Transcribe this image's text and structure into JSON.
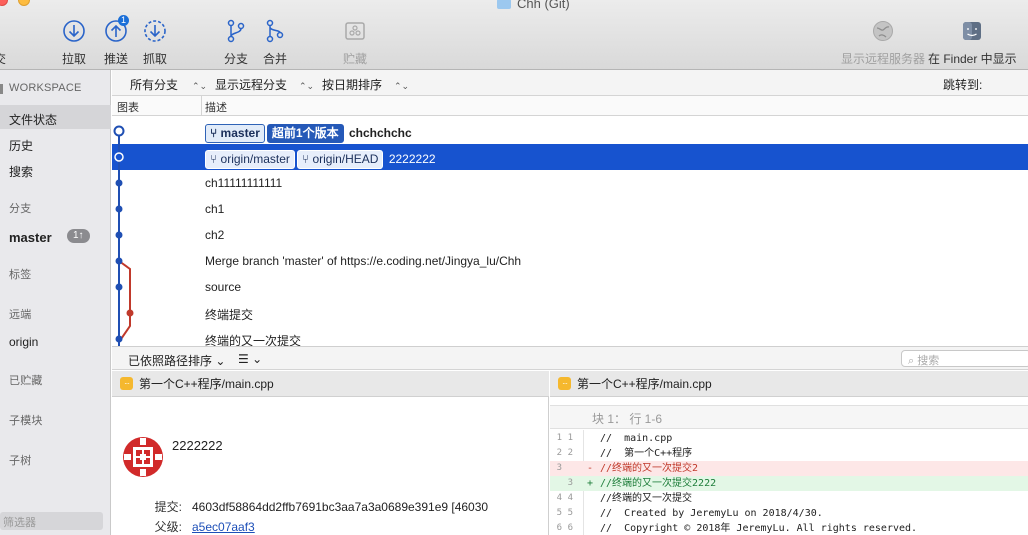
{
  "window": {
    "title": "Chh (Git)"
  },
  "toolbar": {
    "partial_label": "交",
    "pull": "拉取",
    "push": "推送",
    "push_badge": "1",
    "fetch": "抓取",
    "branch": "分支",
    "merge": "合并",
    "stash": "贮藏",
    "show_remote": "显示远程服务器",
    "show_in_finder": "在 Finder 中显示"
  },
  "sidebar": {
    "workspace": "WORKSPACE",
    "file_status": "文件状态",
    "history": "历史",
    "search": "搜索",
    "branches": "分支",
    "master": "master",
    "master_badge": "1↑",
    "tags": "标签",
    "remotes": "远端",
    "origin": "origin",
    "stashes": "已贮藏",
    "submodules": "子模块",
    "subtrees": "子树",
    "filter_placeholder": "筛选器"
  },
  "filterbar": {
    "all_branches": "所有分支",
    "show_remote_branches": "显示远程分支",
    "sort_by_date": "按日期排序",
    "jump_to": "跳转到:"
  },
  "columns": {
    "graph": "图表",
    "description": "描述"
  },
  "commits": [
    {
      "refs": [
        "master"
      ],
      "ahead": "超前1个版本",
      "message": "chchchchc",
      "bold": true
    },
    {
      "refs": [
        "origin/master",
        "origin/HEAD"
      ],
      "message": "2222222",
      "selected": true
    },
    {
      "refs": [],
      "message": "ch11111111111"
    },
    {
      "refs": [],
      "message": "ch1"
    },
    {
      "refs": [],
      "message": "ch2"
    },
    {
      "refs": [],
      "message": "Merge branch 'master' of https://e.coding.net/Jingya_lu/Chh"
    },
    {
      "refs": [],
      "message": "source"
    },
    {
      "refs": [],
      "message": "终端提交"
    },
    {
      "refs": [],
      "message": "终端的又一次提交"
    }
  ],
  "options": {
    "sort_by_path": "已依照路径排序 ⌄",
    "view_mode": "☰ ⌄",
    "search_placeholder": "搜索"
  },
  "detail": {
    "file": "第一个C++程序/main.cpp",
    "message": "2222222",
    "commit_label": "提交:",
    "commit_hash": "4603df58864dd2ffb7691bc3aa7a3a0689e391e9 [46030",
    "parent_label": "父级:",
    "parent_hash": "a5ec07aaf3"
  },
  "diff": {
    "file": "第一个C++程序/main.cpp",
    "hunk": "块 1：  行 1-6",
    "lines": [
      {
        "old": "1",
        "new": "1",
        "sign": "",
        "text": "//  main.cpp",
        "type": "ctx"
      },
      {
        "old": "2",
        "new": "2",
        "sign": "",
        "text": "//  第一个C++程序",
        "type": "ctx"
      },
      {
        "old": "3",
        "new": "",
        "sign": "-",
        "text": "//终端的又一次提交2",
        "type": "del"
      },
      {
        "old": "",
        "new": "3",
        "sign": "+",
        "text": "//终端的又一次提交2222",
        "type": "add"
      },
      {
        "old": "4",
        "new": "4",
        "sign": "",
        "text": "//终端的又一次提交",
        "type": "ctx"
      },
      {
        "old": "5",
        "new": "5",
        "sign": "",
        "text": "//  Created by JeremyLu on 2018/4/30.",
        "type": "ctx"
      },
      {
        "old": "6",
        "new": "6",
        "sign": "",
        "text": "//  Copyright © 2018年 JeremyLu. All rights reserved.",
        "type": "ctx"
      }
    ]
  },
  "colors": {
    "selection": "#1753cf",
    "graph_blue": "#1f4fb3",
    "graph_red": "#c0392b"
  }
}
